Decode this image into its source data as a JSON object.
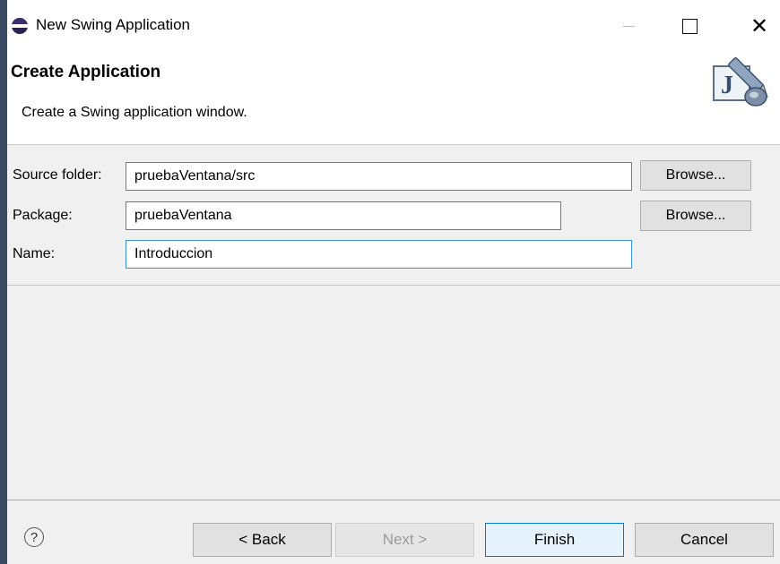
{
  "window": {
    "title": "New Swing Application",
    "icon": "eclipse-icon",
    "controls": {
      "minimize": "—",
      "maximize": "☐",
      "close": "✕"
    }
  },
  "banner": {
    "title": "Create Application",
    "description": "Create a Swing application window.",
    "icon": "java-wizard-icon",
    "icon_letter": "J"
  },
  "form": {
    "source_folder": {
      "label": "Source folder:",
      "value": "pruebaVentana/src",
      "browse_label": "Browse..."
    },
    "package": {
      "label": "Package:",
      "value": "pruebaVentana",
      "browse_label": "Browse..."
    },
    "name": {
      "label": "Name:",
      "value": "Introduccion"
    }
  },
  "footer": {
    "help_icon": "?",
    "back_label": "< Back",
    "next_label": "Next >",
    "finish_label": "Finish",
    "cancel_label": "Cancel"
  },
  "colors": {
    "desktop": "#3a4a63",
    "dialog": "#f0f0f0",
    "focus_border": "#3c8ee0",
    "default_button_border": "#0078d7"
  }
}
